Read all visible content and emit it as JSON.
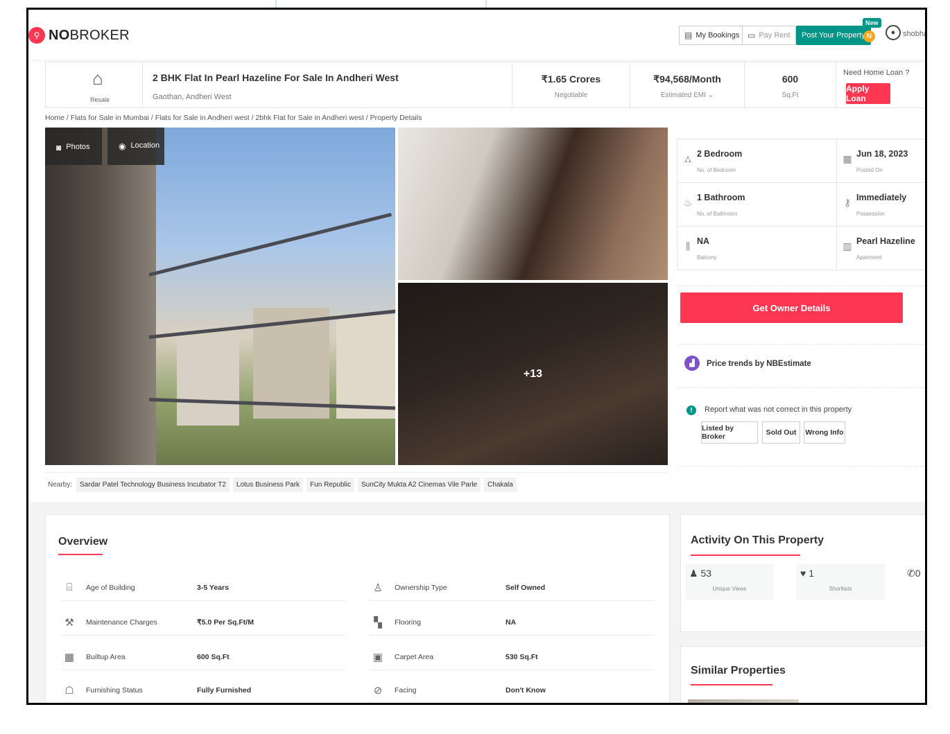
{
  "header": {
    "logo_bold": "NO",
    "logo_rest": "BROKER",
    "my_bookings": "My Bookings",
    "pay_rent": "Pay Rent",
    "post_property": "Post Your Property",
    "new_badge": "New",
    "coin_letter": "N",
    "username": "shobha"
  },
  "listing": {
    "tag": "Resale",
    "title": "2 BHK Flat In Pearl Hazeline For Sale In Andheri West",
    "location": "Gaothan, Andheri West",
    "price": "₹1.65 Crores",
    "price_note": "Negotiable",
    "emi": "₹94,568/Month",
    "emi_note": "Estimated EMI",
    "area": "600",
    "area_unit": "Sq.Ft",
    "loan_question": "Need Home Loan ?",
    "apply_loan": "Apply Loan"
  },
  "breadcrumb": "Home / Flats for Sale in Mumbai / Flats for Sale in Andheri west / 2bhk Flat for Sale in Andheri west / Property Details",
  "gallery": {
    "photos_tab": "Photos",
    "location_tab": "Location",
    "more_count": "+13"
  },
  "details": [
    {
      "value": "2 Bedroom",
      "caption": "No. of Bedroom",
      "icon": "bed-icon"
    },
    {
      "value": "Jun 18, 2023",
      "caption": "Posted On",
      "icon": "calendar-icon"
    },
    {
      "value": "1 Bathroom",
      "caption": "No. of Bathroom",
      "icon": "bathtub-icon"
    },
    {
      "value": "Immediately",
      "caption": "Possession",
      "icon": "key-icon"
    },
    {
      "value": "NA",
      "caption": "Balcony",
      "icon": "balcony-icon"
    },
    {
      "value": "Pearl Hazeline",
      "caption": "Apartment",
      "icon": "building-icon"
    }
  ],
  "actions": {
    "get_owner": "Get Owner Details",
    "price_trends": "Price trends by NBEstimate",
    "report_text": "Report what was not correct in this property",
    "listed_by_broker": "Listed by Broker",
    "sold_out": "Sold Out",
    "wrong_info": "Wrong Info"
  },
  "nearby": {
    "label": "Nearby:",
    "places": [
      "Sardar Patel Technology Business Incubator T2",
      "Lotus Business Park",
      "Fun Republic",
      "SunCity Mukta A2 Cinemas Vile Parle",
      "Chakala"
    ]
  },
  "overview": {
    "title": "Overview",
    "rows": [
      {
        "label": "Age of Building",
        "value": "3-5 Years"
      },
      {
        "label": "Ownership Type",
        "value": "Self Owned"
      },
      {
        "label": "Maintenance Charges",
        "value": "₹5.0 Per Sq.Ft/M"
      },
      {
        "label": "Flooring",
        "value": "NA"
      },
      {
        "label": "Builtup Area",
        "value": "600 Sq.Ft"
      },
      {
        "label": "Carpet Area",
        "value": "530 Sq.Ft"
      },
      {
        "label": "Furnishing Status",
        "value": "Fully Furnished"
      },
      {
        "label": "Facing",
        "value": "Don't Know"
      }
    ]
  },
  "activity": {
    "title": "Activity On This Property",
    "views": "53",
    "views_label": "Unique Views",
    "shortlists": "1",
    "shortlists_label": "Shortlists",
    "contacts": "0"
  },
  "similar": {
    "title": "Similar Properties"
  },
  "colors": {
    "brand_red": "#fd3752",
    "brand_green": "#009587"
  }
}
